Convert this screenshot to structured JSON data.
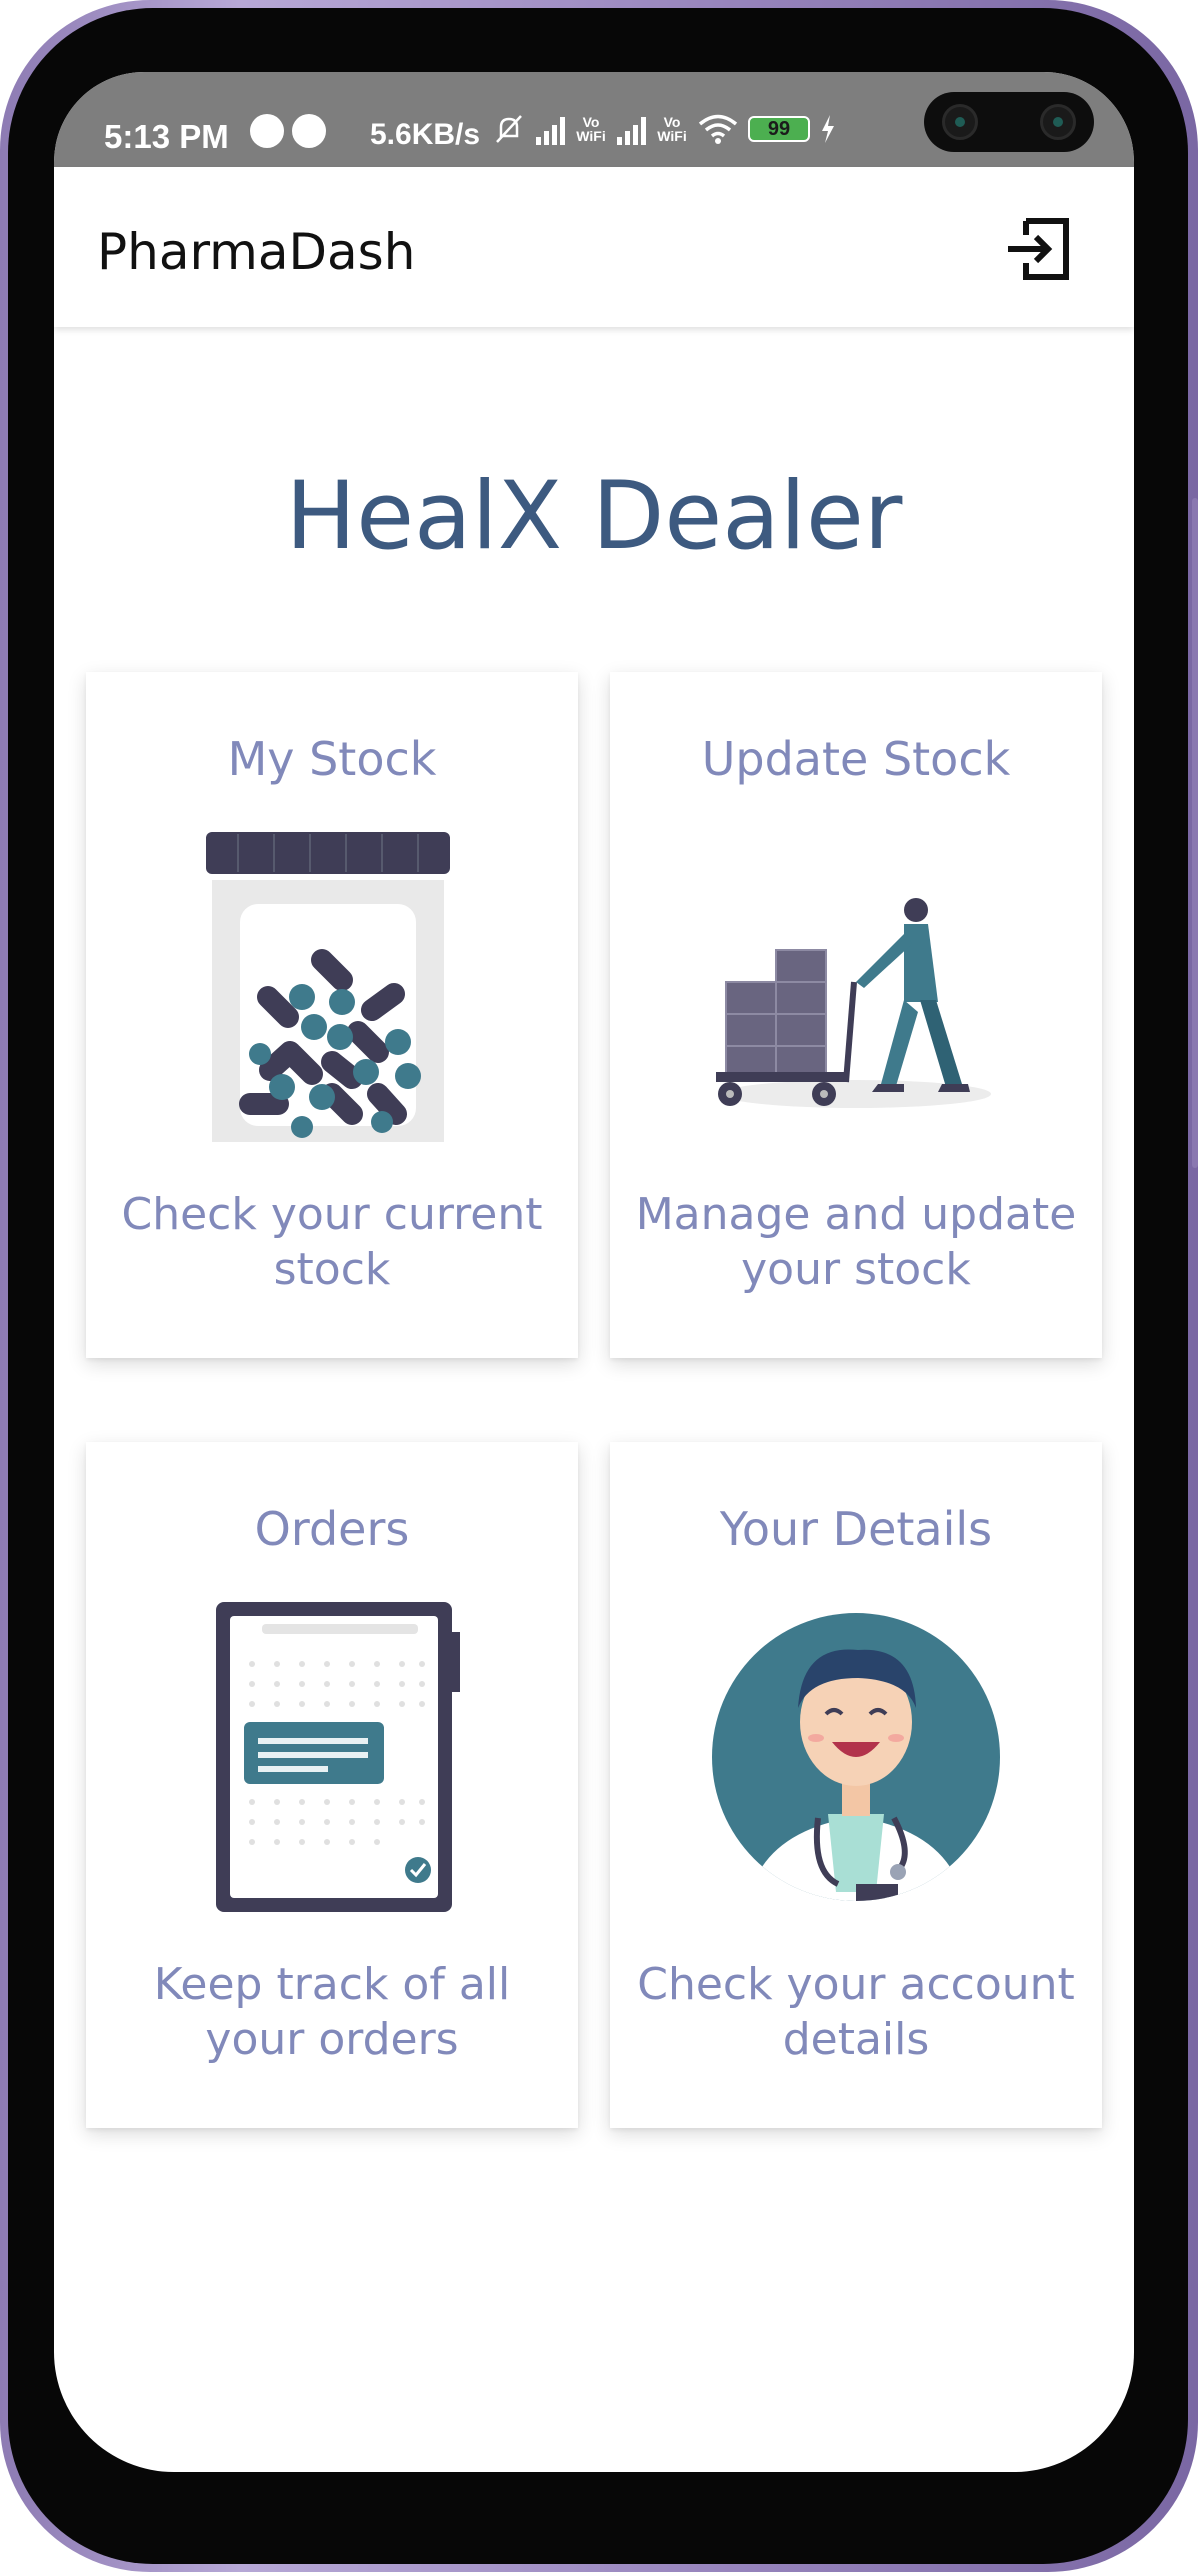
{
  "status_bar": {
    "time": "5:13 PM",
    "net_speed": "5.6KB/s",
    "vowifi_1": "Vo WiFi",
    "vowifi_2": "Vo WiFi",
    "battery": "99"
  },
  "app_bar": {
    "title": "PharmaDash",
    "logout_icon": "logout-icon"
  },
  "main": {
    "heading": "HealX Dealer",
    "cards": [
      {
        "title": "My Stock",
        "description": "Check your current stock",
        "icon": "pill-jar-icon"
      },
      {
        "title": "Update Stock",
        "description": "Manage and update your stock",
        "icon": "delivery-cart-icon"
      },
      {
        "title": "Orders",
        "description": "Keep track of all your orders",
        "icon": "tablet-orders-icon"
      },
      {
        "title": "Your Details",
        "description": "Check your account details",
        "icon": "doctor-avatar-icon"
      }
    ]
  },
  "colors": {
    "heading": "#3d5a80",
    "card_text": "#8189ba",
    "status_bar": "#7e7e7e",
    "accent_teal": "#3f7a8c",
    "illustration_dark": "#3f3d56"
  }
}
